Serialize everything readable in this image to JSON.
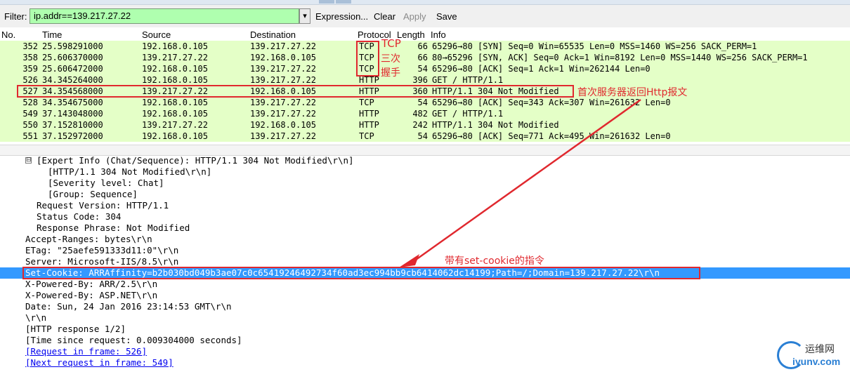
{
  "filter": {
    "label": "Filter:",
    "value": "ip.addr==139.217.27.22",
    "expression_label": "Expression...",
    "clear_label": "Clear",
    "apply_label": "Apply",
    "save_label": "Save"
  },
  "columns": [
    "No.",
    "Time",
    "Source",
    "Destination",
    "Protocol",
    "Length",
    "Info"
  ],
  "packets": [
    {
      "no": "352",
      "time": "25.598291000",
      "src": "192.168.0.105",
      "dst": "139.217.27.22",
      "proto": "TCP",
      "len": "66",
      "info": "65296→80 [SYN] Seq=0 Win=65535 Len=0 MSS=1460 WS=256 SACK_PERM=1"
    },
    {
      "no": "358",
      "time": "25.606370000",
      "src": "139.217.27.22",
      "dst": "192.168.0.105",
      "proto": "TCP",
      "len": "66",
      "info": "80→65296 [SYN, ACK] Seq=0 Ack=1 Win=8192 Len=0 MSS=1440 WS=256 SACK_PERM=1"
    },
    {
      "no": "359",
      "time": "25.606472000",
      "src": "192.168.0.105",
      "dst": "139.217.27.22",
      "proto": "TCP",
      "len": "54",
      "info": "65296→80 [ACK] Seq=1 Ack=1 Win=262144 Len=0"
    },
    {
      "no": "526",
      "time": "34.345264000",
      "src": "192.168.0.105",
      "dst": "139.217.27.22",
      "proto": "HTTP",
      "len": "396",
      "info": "GET / HTTP/1.1"
    },
    {
      "no": "527",
      "time": "34.354568000",
      "src": "139.217.27.22",
      "dst": "192.168.0.105",
      "proto": "HTTP",
      "len": "360",
      "info": "HTTP/1.1 304 Not Modified"
    },
    {
      "no": "528",
      "time": "34.354675000",
      "src": "192.168.0.105",
      "dst": "139.217.27.22",
      "proto": "TCP",
      "len": "54",
      "info": "65296→80 [ACK] Seq=343 Ack=307 Win=261632 Len=0"
    },
    {
      "no": "549",
      "time": "37.143048000",
      "src": "192.168.0.105",
      "dst": "139.217.27.22",
      "proto": "HTTP",
      "len": "482",
      "info": "GET / HTTP/1.1"
    },
    {
      "no": "550",
      "time": "37.152810000",
      "src": "139.217.27.22",
      "dst": "192.168.0.105",
      "proto": "HTTP",
      "len": "242",
      "info": "HTTP/1.1 304 Not Modified"
    },
    {
      "no": "551",
      "time": "37.152972000",
      "src": "192.168.0.105",
      "dst": "139.217.27.22",
      "proto": "TCP",
      "len": "54",
      "info": "65296→80 [ACK] Seq=771 Ack=495 Win=261632 Len=0"
    }
  ],
  "details": [
    {
      "text": "[Expert Info (Chat/Sequence): HTTP/1.1 304 Not Modified\\r\\n]",
      "toggle": "⊟",
      "link": false,
      "selected": false
    },
    {
      "text": "[HTTP/1.1 304 Not Modified\\r\\n]",
      "link": false,
      "selected": false
    },
    {
      "text": "[Severity level: Chat]",
      "link": false,
      "selected": false
    },
    {
      "text": "[Group: Sequence]",
      "link": false,
      "selected": false
    },
    {
      "text": "Request Version: HTTP/1.1",
      "link": false,
      "selected": false
    },
    {
      "text": "Status Code: 304",
      "link": false,
      "selected": false
    },
    {
      "text": "Response Phrase: Not Modified",
      "link": false,
      "selected": false
    },
    {
      "text": "Accept-Ranges: bytes\\r\\n",
      "link": false,
      "selected": false
    },
    {
      "text": "ETag: \"25aefe591333d11:0\"\\r\\n",
      "link": false,
      "selected": false
    },
    {
      "text": "Server: Microsoft-IIS/8.5\\r\\n",
      "link": false,
      "selected": false
    },
    {
      "text": "Set-Cookie: ARRAffinity=b2b030bd049b3ae07c0c65419246492734f60ad3ec994bb9cb6414062dc14199;Path=/;Domain=139.217.27.22\\r\\n",
      "link": false,
      "selected": true
    },
    {
      "text": "X-Powered-By: ARR/2.5\\r\\n",
      "link": false,
      "selected": false
    },
    {
      "text": "X-Powered-By: ASP.NET\\r\\n",
      "link": false,
      "selected": false
    },
    {
      "text": "Date: Sun, 24 Jan 2016 23:14:53 GMT\\r\\n",
      "link": false,
      "selected": false
    },
    {
      "text": "\\r\\n",
      "link": false,
      "selected": false
    },
    {
      "text": "[HTTP response 1/2]",
      "link": false,
      "selected": false
    },
    {
      "text": "[Time since request: 0.009304000 seconds]",
      "link": false,
      "selected": false
    },
    {
      "text": "[Request in frame: 526]",
      "link": true,
      "selected": false
    },
    {
      "text": "[Next request in frame: 549]",
      "link": true,
      "selected": false
    }
  ],
  "annotations": {
    "tcp_label": "TCP",
    "tcp_handshake_line1": "三次",
    "tcp_handshake_line2": "握手",
    "first_response_label": "首次服务器返回Http报文",
    "set_cookie_label": "带有set-cookie的指令",
    "accent_color": "#e0282e"
  },
  "watermark": {
    "cn_text": "运维网",
    "en_text": "iyunv.com"
  },
  "colors": {
    "filter_valid": "#afffaf",
    "row_bg": "#e4ffc7",
    "selection": "#3399ff"
  }
}
